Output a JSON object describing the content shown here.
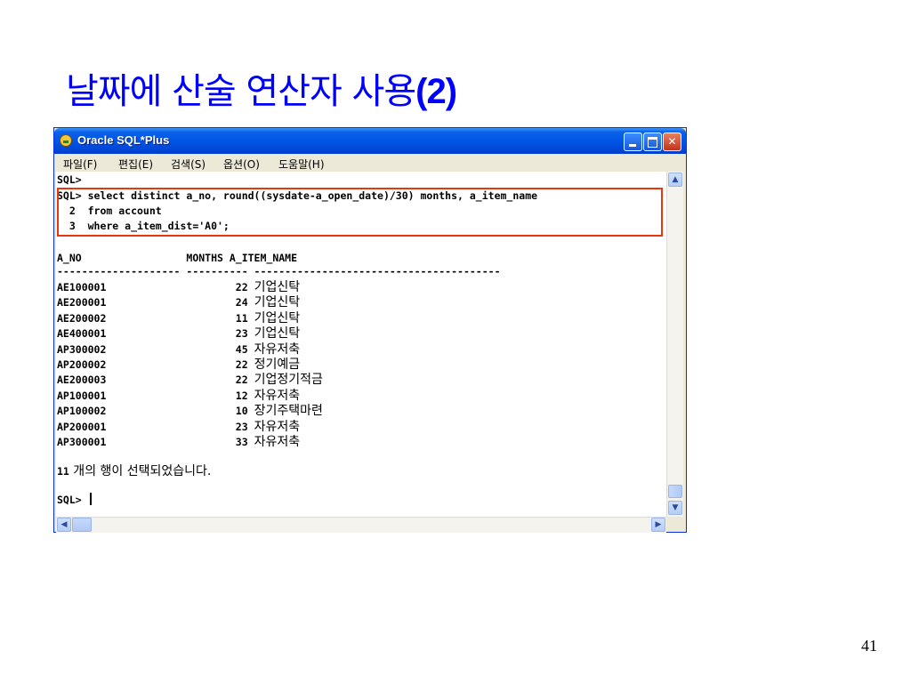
{
  "slide": {
    "title": "날짜에 산술 연산자 사용",
    "title_number": "(2)",
    "page_number": "41"
  },
  "window": {
    "title": "Oracle SQL*Plus",
    "icon": "sqlplus-app-icon",
    "controls": {
      "minimize": "minimize-icon",
      "maximize": "maximize-icon",
      "close": "✕"
    }
  },
  "menu": [
    "파일(F)",
    "편집(E)",
    "검색(S)",
    "옵션(O)",
    "도움말(H)"
  ],
  "console": {
    "lines": [
      "SQL>",
      "SQL> select distinct a_no, round((sysdate-a_open_date)/30) months, a_item_name",
      "  2  from account",
      "  3  where a_item_dist='A0';",
      "",
      "A_NO                 MONTHS A_ITEM_NAME",
      "-------------------- ---------- ----------------------------------------"
    ],
    "rows": [
      {
        "a_no": "AE100001",
        "months": "22",
        "item": "기업신탁"
      },
      {
        "a_no": "AE200001",
        "months": "24",
        "item": "기업신탁"
      },
      {
        "a_no": "AE200002",
        "months": "11",
        "item": "기업신탁"
      },
      {
        "a_no": "AE400001",
        "months": "23",
        "item": "기업신탁"
      },
      {
        "a_no": "AP300002",
        "months": "45",
        "item": "자유저축"
      },
      {
        "a_no": "AP200002",
        "months": "22",
        "item": "정기예금"
      },
      {
        "a_no": "AE200003",
        "months": "22",
        "item": "기업정기적금"
      },
      {
        "a_no": "AP100001",
        "months": "12",
        "item": "자유저축"
      },
      {
        "a_no": "AP100002",
        "months": "10",
        "item": "장기주택마련"
      },
      {
        "a_no": "AP200001",
        "months": "23",
        "item": "자유저축"
      },
      {
        "a_no": "AP300001",
        "months": "33",
        "item": "자유저축"
      }
    ],
    "result_count": "11",
    "result_message": " 개의 행이 선택되었습니다.",
    "prompt": "SQL>"
  },
  "scrollbars": {
    "up": "▲",
    "down": "▼",
    "left": "◀",
    "right": "▶"
  },
  "colors": {
    "title": "#0000ff",
    "highlight": "#e8360e",
    "titlebar": "#0055e5"
  }
}
